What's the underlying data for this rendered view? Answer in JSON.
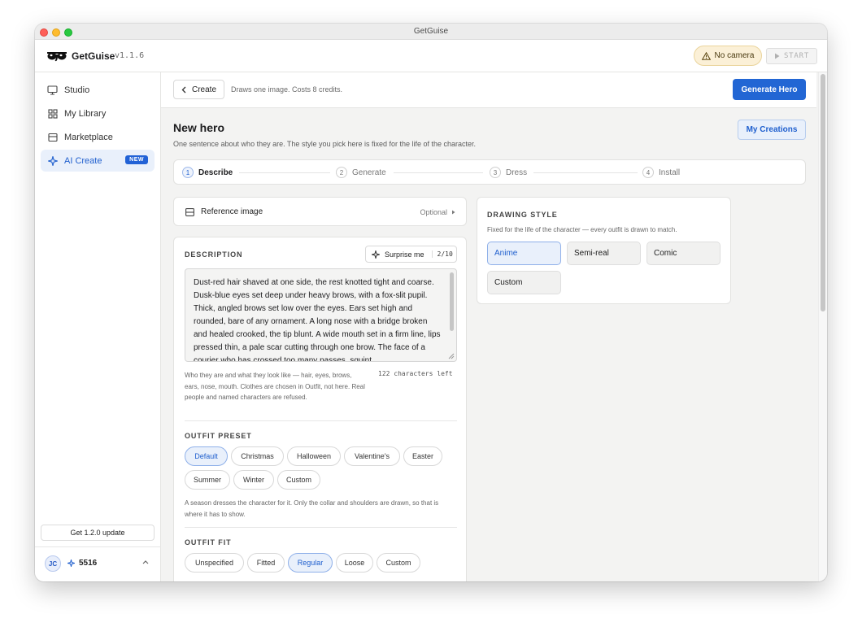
{
  "window": {
    "title": "GetGuise"
  },
  "header": {
    "app_name": "GetGuise",
    "version": "v1.1.6",
    "camera_status": "No camera",
    "start_label": "START"
  },
  "sidebar": {
    "items": [
      {
        "label": "Studio",
        "icon": "monitor-icon"
      },
      {
        "label": "My Library",
        "icon": "grid-icon"
      },
      {
        "label": "Marketplace",
        "icon": "store-icon"
      },
      {
        "label": "AI Create",
        "icon": "sparkle-icon",
        "badge": "NEW",
        "active": true
      }
    ],
    "update_label": "Get 1.2.0 update",
    "user": {
      "initials": "JC",
      "credits": "5516"
    }
  },
  "toolbar": {
    "back_label": "Create",
    "note": "Draws one image. Costs 8 credits.",
    "generate_label": "Generate Hero"
  },
  "page": {
    "title": "New hero",
    "subtitle": "One sentence about who they are. The style you pick here is fixed for the life of the character.",
    "my_creations_label": "My Creations"
  },
  "steps": [
    {
      "num": "1",
      "label": "Describe",
      "active": true
    },
    {
      "num": "2",
      "label": "Generate"
    },
    {
      "num": "3",
      "label": "Dress"
    },
    {
      "num": "4",
      "label": "Install"
    }
  ],
  "reference": {
    "label": "Reference image",
    "optional_label": "Optional"
  },
  "description": {
    "label": "DESCRIPTION",
    "surprise_label": "Surprise me",
    "surprise_count": "2/10",
    "text": "Dust-red hair shaved at one side, the rest knotted tight and coarse. Dusk-blue eyes set deep under heavy brows, with a fox-slit pupil. Thick, angled brows set low over the eyes. Ears set high and rounded, bare of any ornament. A long nose with a bridge broken and healed crooked, the tip blunt. A wide mouth set in a firm line, lips pressed thin, a pale scar cutting through one brow. The face of a courier who has crossed too many passes, squint",
    "help": "Who they are and what they look like — hair, eyes, brows, ears, nose, mouth. Clothes are chosen in Outfit, not here. Real people and named characters are refused.",
    "chars_left": "122 characters left"
  },
  "outfit_preset": {
    "label": "OUTFIT PRESET",
    "options": [
      "Default",
      "Christmas",
      "Halloween",
      "Valentine's",
      "Easter",
      "Summer",
      "Winter",
      "Custom"
    ],
    "selected": "Default",
    "help": "A season dresses the character for it. Only the collar and shoulders are drawn, so that is where it has to show."
  },
  "outfit_fit": {
    "label": "OUTFIT FIT",
    "options": [
      "Unspecified",
      "Fitted",
      "Regular",
      "Loose",
      "Custom"
    ],
    "selected": "Regular"
  },
  "drawing_style": {
    "label": "DRAWING STYLE",
    "help": "Fixed for the life of the character — every outfit is drawn to match.",
    "options": [
      "Anime",
      "Semi-real",
      "Comic",
      "Custom"
    ],
    "selected": "Anime"
  },
  "colors": {
    "accent": "#2266d4",
    "accent_soft": "#e9f0fb",
    "warning_bg": "#fbf0d7"
  }
}
